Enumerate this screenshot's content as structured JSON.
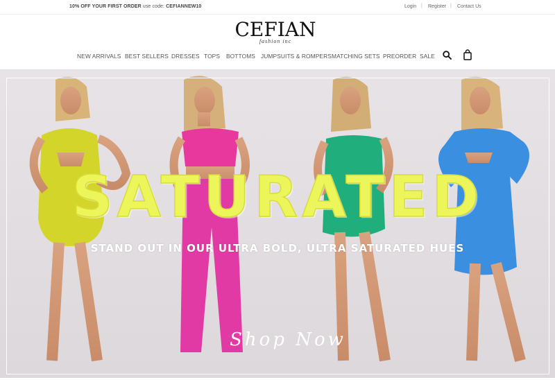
{
  "topbar": {
    "promo_strong": "10% OFF YOUR FIRST ORDER",
    "promo_text": "use code:",
    "promo_code": "CEFIANNEW10",
    "login": "Login",
    "register": "Register",
    "contact": "Contact Us",
    "separator": "|"
  },
  "logo": {
    "main": "CEFIAN",
    "sub": "fashion inc"
  },
  "nav": {
    "items": [
      "NEW ARRIVALS",
      "BEST SELLERS",
      "DRESSES",
      "TOPS",
      "BOTTOMS",
      "JUMPSUITS & ROMPERS",
      "MATCHING SETS",
      "PREORDER",
      "SALE"
    ]
  },
  "icons": {
    "search": "search-icon",
    "cart": "shopping-bag-icon"
  },
  "hero": {
    "title": "SATURATED",
    "subtitle": "STAND OUT IN OUR ULTRA BOLD, ULTRA SATURATED HUES",
    "cta": "Shop Now",
    "colors": {
      "yellow": "#d4d52a",
      "pink": "#e8389e",
      "green": "#1fae7c",
      "blue": "#3a8fe0",
      "title": "#ecf55a"
    }
  }
}
